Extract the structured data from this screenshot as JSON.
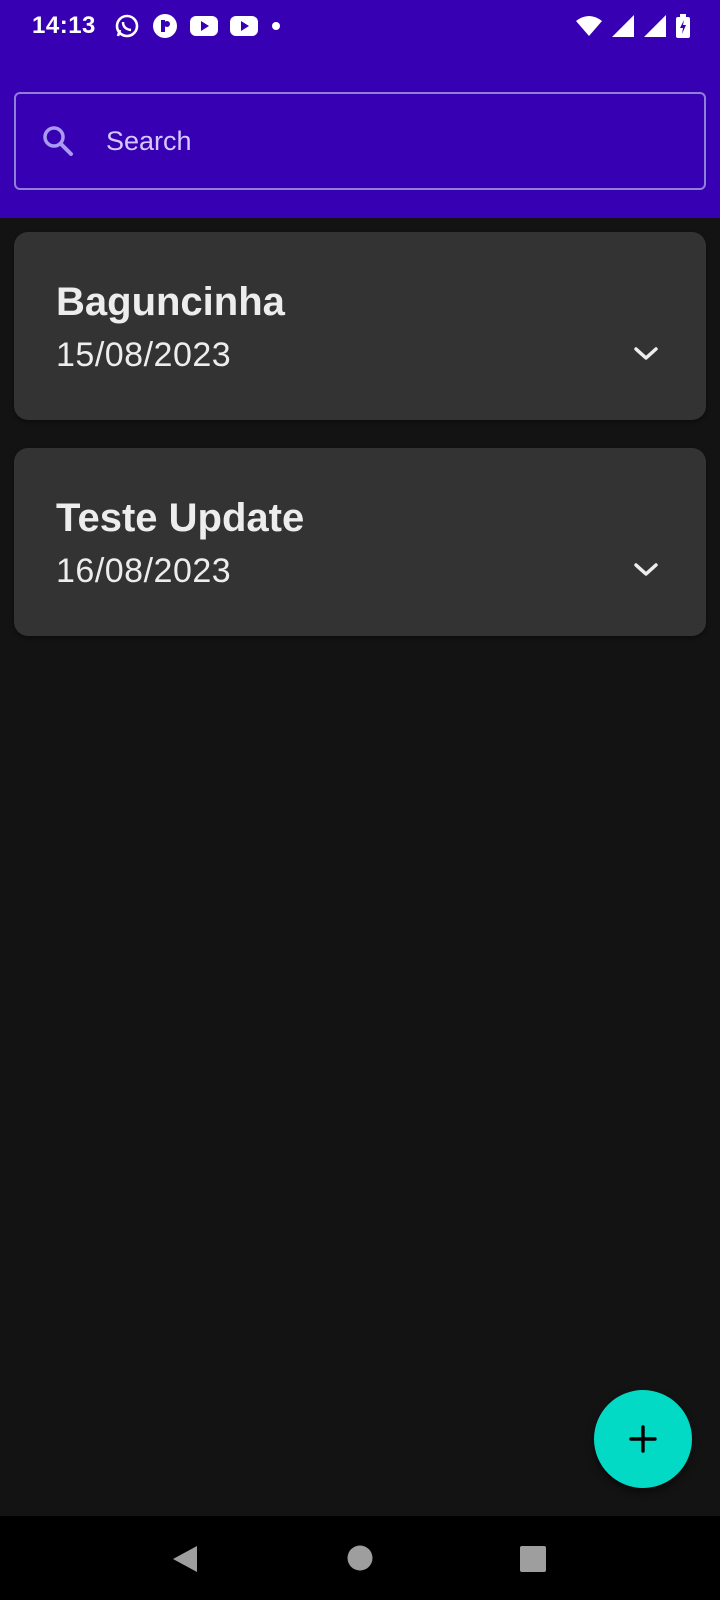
{
  "colors": {
    "accent": "#3700b3",
    "background": "#131313",
    "card": "#333333",
    "fab": "#03dac5"
  },
  "status_bar": {
    "time": "14:13",
    "left_icons": [
      "whatsapp-icon",
      "app-icon",
      "youtube-icon",
      "youtube-icon",
      "dot-icon"
    ],
    "right_icons": [
      "wifi-icon",
      "signal-icon",
      "signal-icon",
      "battery-icon"
    ]
  },
  "search": {
    "placeholder": "Search",
    "value": "",
    "icon": "search-icon"
  },
  "notes": [
    {
      "title": "Baguncinha",
      "date": "15/08/2023"
    },
    {
      "title": "Teste Update",
      "date": "16/08/2023"
    }
  ],
  "fab": {
    "icon": "plus-icon"
  },
  "nav_bar": {
    "icons": [
      "back-icon",
      "home-icon",
      "recents-icon"
    ]
  }
}
